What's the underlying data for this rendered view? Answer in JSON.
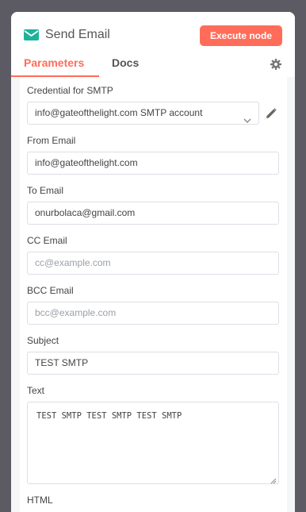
{
  "header": {
    "title": "Send Email",
    "execute_label": "Execute node",
    "icon": "mail-icon",
    "accent_color": "#ff6d5a",
    "icon_color": "#1fb29a"
  },
  "tabs": [
    {
      "label": "Parameters",
      "active": true
    },
    {
      "label": "Docs",
      "active": false
    }
  ],
  "form": {
    "credential": {
      "label": "Credential for SMTP",
      "value": "info@gateofthelight.com SMTP account"
    },
    "from_email": {
      "label": "From Email",
      "value": "info@gateofthelight.com"
    },
    "to_email": {
      "label": "To Email",
      "value": "onurbolaca@gmail.com"
    },
    "cc_email": {
      "label": "CC Email",
      "placeholder": "cc@example.com"
    },
    "bcc_email": {
      "label": "BCC Email",
      "placeholder": "bcc@example.com"
    },
    "subject": {
      "label": "Subject",
      "value": "TEST SMTP"
    },
    "text": {
      "label": "Text",
      "value": "TEST SMTP TEST SMTP TEST SMTP"
    },
    "html": {
      "label": "HTML"
    }
  }
}
